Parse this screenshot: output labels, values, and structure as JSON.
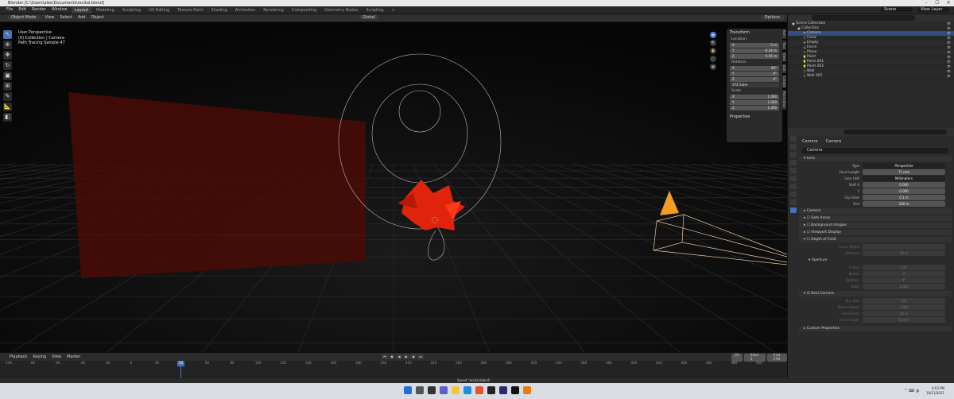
{
  "window": {
    "title": "Blender [C:\\Users\\alex\\Documents\\recital.blend]",
    "minimize": "–",
    "maximize": "☐",
    "close": "✕"
  },
  "topbar": {
    "menu": [
      "File",
      "Edit",
      "Render",
      "Window",
      "Help"
    ],
    "workspaces": [
      "Layout",
      "Modeling",
      "Sculpting",
      "UV Editing",
      "Texture Paint",
      "Shading",
      "Animation",
      "Rendering",
      "Compositing",
      "Geometry Nodes",
      "Scripting",
      "+"
    ],
    "active_workspace": "Layout",
    "scene": "Scene",
    "view_layer": "View Layer"
  },
  "viewport_header": {
    "mode": "Object Mode",
    "menu": [
      "View",
      "Select",
      "Add",
      "Object"
    ],
    "transform": "Global",
    "options": "Options"
  },
  "overlay": {
    "line1": "User Perspective",
    "line2": "(0) Collection | Camera",
    "line3": "Path Tracing Sample 47"
  },
  "npanel": {
    "transform": "Transform",
    "location": "Location",
    "loc": [
      [
        "X",
        "0 m"
      ],
      [
        "Y",
        "-0.34 m"
      ],
      [
        "Z",
        "0.45 m"
      ]
    ],
    "rotation": "Rotation",
    "rot": [
      [
        "X",
        "90°"
      ],
      [
        "Y",
        "0°"
      ],
      [
        "Z",
        "0°"
      ]
    ],
    "euler": "XYZ Euler",
    "scale": "Scale",
    "sc": [
      [
        "X",
        "1.000"
      ],
      [
        "Y",
        "1.000"
      ],
      [
        "Z",
        "1.000"
      ]
    ],
    "properties": "Properties",
    "tabs": [
      "Item",
      "Tool",
      "View",
      "Edit",
      "Create",
      "Animation"
    ]
  },
  "timeline": {
    "menu": [
      "Playback",
      "Keying",
      "View",
      "Marker"
    ],
    "current_frame": "33",
    "start_label": "Start",
    "start": "1",
    "end_label": "End",
    "end": "250",
    "ticks": [
      "-100",
      "-80",
      "-60",
      "-40",
      "-20",
      "0",
      "20",
      "40",
      "60",
      "80",
      "100",
      "120",
      "140",
      "160",
      "180",
      "200",
      "220",
      "240",
      "260",
      "280",
      "300",
      "320",
      "340",
      "360",
      "380",
      "400",
      "420",
      "440",
      "460",
      "480",
      "500"
    ]
  },
  "statusbar": {
    "message": "Saved \"recital.blend\""
  },
  "taskbar": {
    "time": "4:03 PM",
    "date": "10/11/2021",
    "tray": "^  ⌨  🔊"
  },
  "outliner": {
    "items": [
      {
        "label": "Scene Collection",
        "indent": 0,
        "icon": "▣",
        "sel": false
      },
      {
        "label": "Collection",
        "indent": 1,
        "icon": "▣",
        "sel": false
      },
      {
        "label": "Camera",
        "indent": 2,
        "icon": "📷",
        "sel": true
      },
      {
        "label": "Cone",
        "indent": 2,
        "icon": "▽",
        "sel": false
      },
      {
        "label": "Empty",
        "indent": 2,
        "icon": "✣",
        "sel": false
      },
      {
        "label": "Force",
        "indent": 2,
        "icon": "◎",
        "sel": false
      },
      {
        "label": "Plane",
        "indent": 2,
        "icon": "▽",
        "sel": false
      },
      {
        "label": "Point",
        "indent": 2,
        "icon": "💡",
        "sel": false
      },
      {
        "label": "Point.001",
        "indent": 2,
        "icon": "💡",
        "sel": false
      },
      {
        "label": "Point.002",
        "indent": 2,
        "icon": "💡",
        "sel": false
      },
      {
        "label": "Wall",
        "indent": 2,
        "icon": "▽",
        "sel": false
      },
      {
        "label": "Wall.001",
        "indent": 2,
        "icon": "▽",
        "sel": false
      }
    ]
  },
  "properties": {
    "breadcrumb": [
      "Camera",
      "Camera"
    ],
    "name": "Camera",
    "lens_section": "Lens",
    "lens_rows": [
      {
        "k": "Type",
        "v": "Perspective",
        "dark": true
      },
      {
        "k": "Focal Length",
        "v": "71 mm",
        "dark": false
      },
      {
        "k": "Lens Unit",
        "v": "Millimeters",
        "dark": true
      },
      {
        "k": "Shift X",
        "v": "0.000",
        "dark": false
      },
      {
        "k": "Y",
        "v": "0.000",
        "dark": false
      },
      {
        "k": "Clip Start",
        "v": "0.1 m",
        "dark": false
      },
      {
        "k": "End",
        "v": "100 m",
        "dark": false
      }
    ],
    "sections": [
      "Camera",
      "Safe Areas",
      "Background Images",
      "Viewport Display",
      "Depth of Field"
    ],
    "dof_rows": [
      {
        "k": "Focus Object",
        "v": ""
      },
      {
        "k": "Distance",
        "v": "10 m"
      }
    ],
    "aperture": "Aperture",
    "aperture_rows": [
      {
        "k": "F-Stop",
        "v": "2.8"
      },
      {
        "k": "Blades",
        "v": "0"
      },
      {
        "k": "Rotation",
        "v": "0°"
      },
      {
        "k": "Ratio",
        "v": "1.000"
      }
    ],
    "real_camera": "Real Camera",
    "real_rows": [
      {
        "k": "Blur Size",
        "v": "0.0"
      },
      {
        "k": "Bokeh Aspect",
        "v": "1.000"
      },
      {
        "k": "Focus Point",
        "v": "10 m"
      },
      {
        "k": "Focal Length",
        "v": "50 mm"
      }
    ],
    "custom_props": "Custom Properties"
  }
}
